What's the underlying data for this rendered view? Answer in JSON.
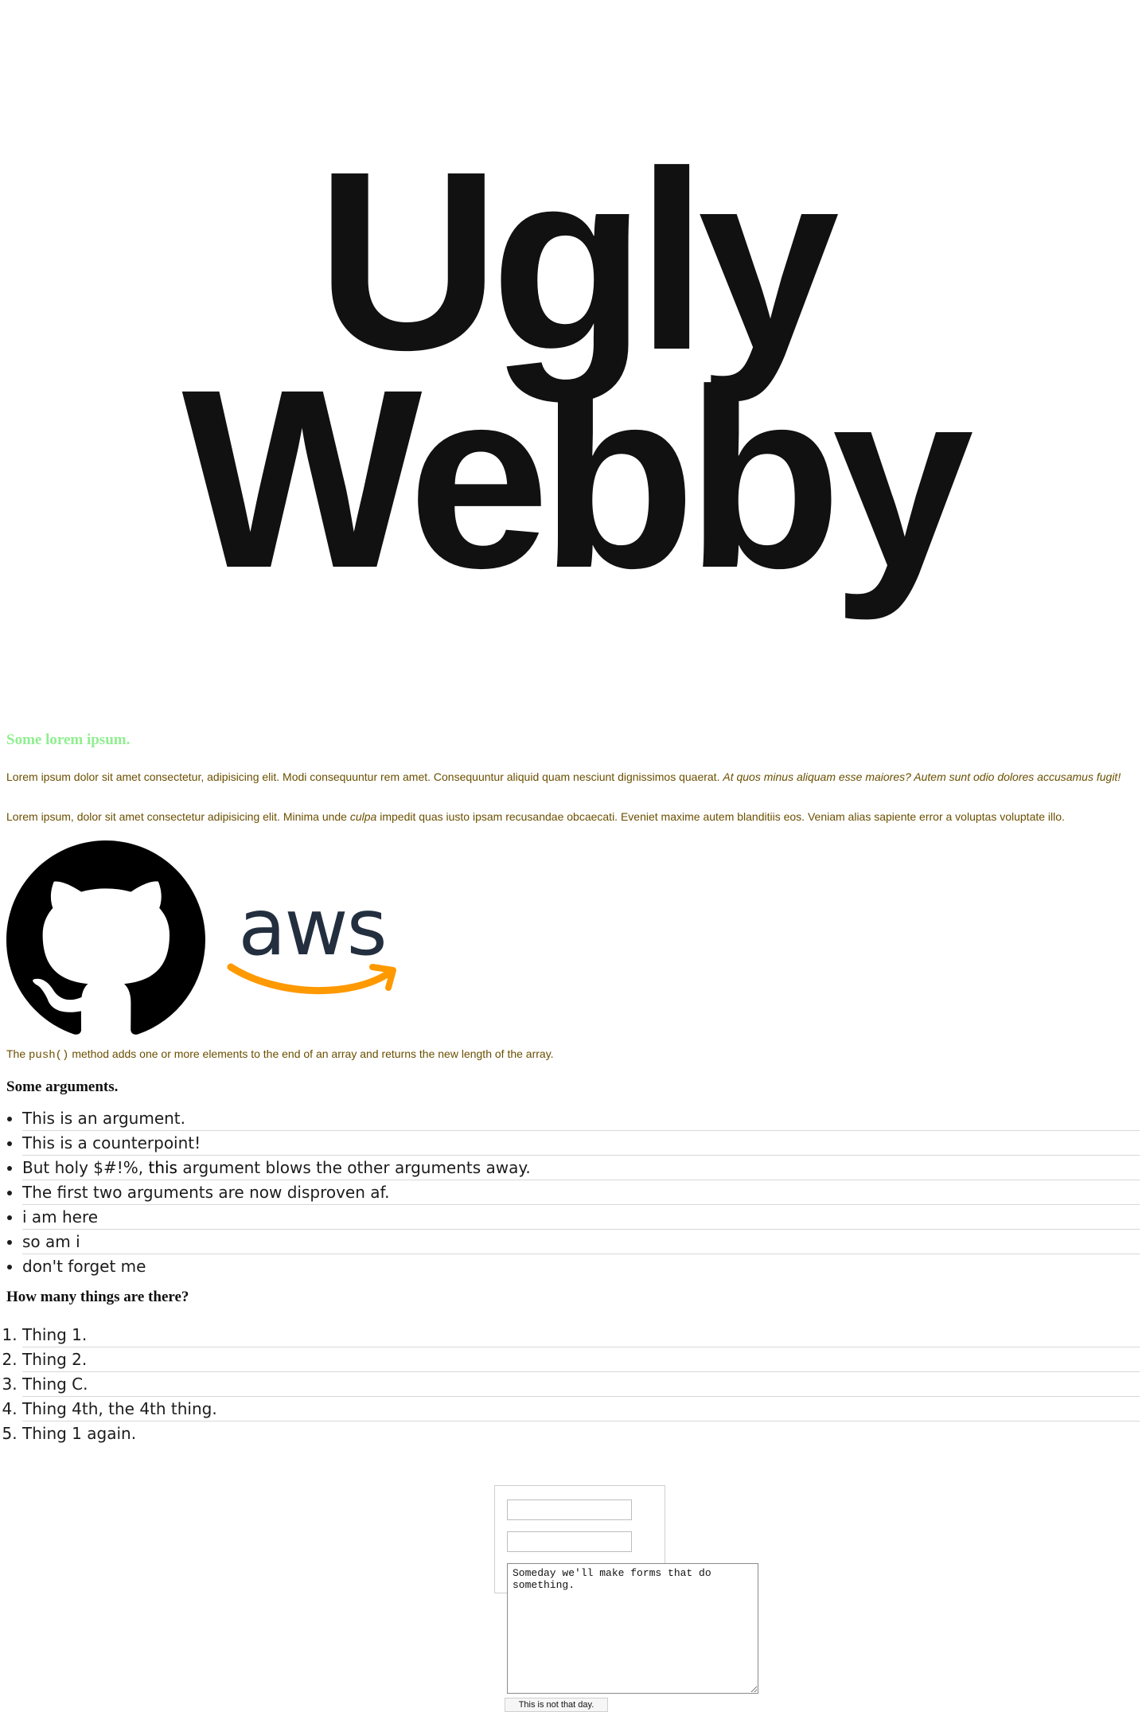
{
  "hero": {
    "line1": "Ugly",
    "line2": "Webby"
  },
  "section1": {
    "heading": "Some lorem ipsum.",
    "p1_plain": "Lorem ipsum dolor sit amet consectetur, adipisicing elit. Modi consequuntur rem amet. Consequuntur aliquid quam nesciunt dignissimos quaerat. ",
    "p1_italic": "At quos minus aliquam esse maiores? Autem sunt odio dolores accusamus fugit!",
    "p2_before": "Lorem ipsum, dolor sit amet consectetur adipisicing elit. Minima unde ",
    "p2_italic": "culpa",
    "p2_after": " impedit quas iusto ipsam recusandae obcaecati. Eveniet maxime autem blanditiis eos. Veniam alias sapiente error a voluptas voluptate illo."
  },
  "logos": {
    "github_icon": "github-octocat-icon",
    "aws_text": "aws",
    "aws_smile_color": "#FF9900",
    "aws_text_color": "#232F3E"
  },
  "push_note": {
    "before": "The ",
    "code": "push()",
    "after": " method adds one or more elements to the end of an array and returns the new length of the array."
  },
  "arguments": {
    "heading": "Some arguments.",
    "items": [
      "This is an argument.",
      "This is a counterpoint!",
      "But holy $#!%, ",
      "The first two arguments are now disproven af.",
      "i am here",
      "so am i",
      "don't forget me"
    ],
    "item3_strong": "this",
    "item3_after": " argument blows the other arguments away."
  },
  "things": {
    "heading": "How many things are there?",
    "items": [
      "Thing 1.",
      "Thing 2.",
      "Thing C.",
      "Thing 4th, the 4th thing.",
      "Thing 1 again."
    ]
  },
  "form": {
    "field1_value": "",
    "field2_value": "",
    "textarea_value": "Someday we'll make forms that do something.",
    "submit_label": "This is not that day."
  }
}
